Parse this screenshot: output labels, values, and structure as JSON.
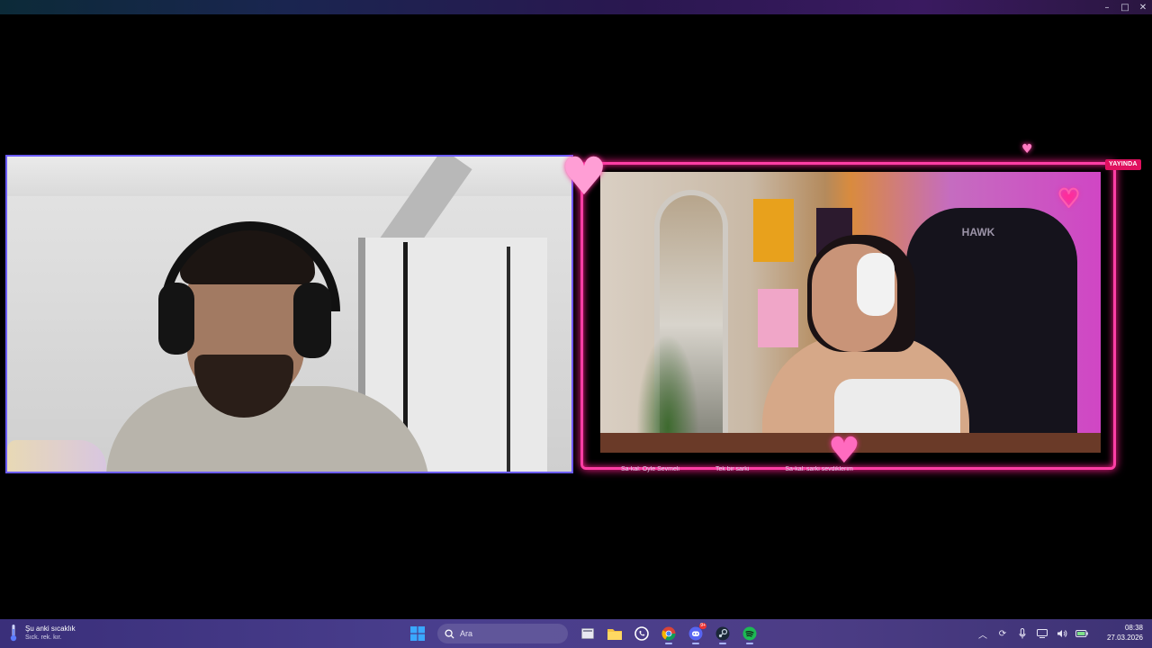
{
  "window": {
    "controls": {
      "minimize": "–",
      "maximize": "□",
      "close": "✕"
    }
  },
  "stream": {
    "live_badge": "YAYINDA",
    "chair_brand": "HAWK",
    "ticker": [
      "Sa-kal: Oyle Sevmeli",
      "Tek bir sarki",
      "Sa-kal: sarki sevdiklerim"
    ]
  },
  "taskbar": {
    "weather": {
      "line1": "Şu anki sıcaklık",
      "line2": "Sıck. rek. kır.",
      "icon": "thermometer-icon"
    },
    "search_placeholder": "Ara",
    "apps": [
      {
        "name": "start",
        "icon": "windows-logo-icon"
      },
      {
        "name": "task-view",
        "icon": "task-view-icon"
      },
      {
        "name": "file-explorer",
        "icon": "folder-icon"
      },
      {
        "name": "whatsapp",
        "icon": "whatsapp-icon"
      },
      {
        "name": "chrome",
        "icon": "chrome-icon"
      },
      {
        "name": "discord",
        "icon": "discord-icon",
        "badge": "9+"
      },
      {
        "name": "steam",
        "icon": "steam-icon"
      },
      {
        "name": "spotify",
        "icon": "spotify-icon"
      }
    ],
    "tray": [
      "chevron-up-icon",
      "sync-icon",
      "microphone-icon",
      "network-icon",
      "volume-icon",
      "battery-icon"
    ],
    "clock": {
      "time": "08:38",
      "date": "27.03.2026"
    }
  },
  "colors": {
    "accent_frame": "#ff3ea5",
    "left_border": "#6b5cff",
    "taskbar": "#4a3f8e",
    "live": "#e0115f"
  }
}
